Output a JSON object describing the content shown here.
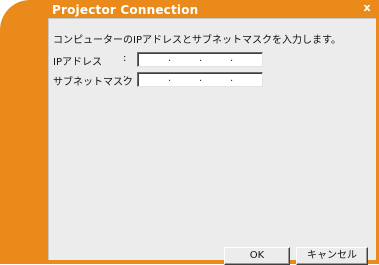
{
  "window": {
    "title": "Projector Connection",
    "close_label": "x",
    "accent_color": "#e98a1a"
  },
  "main": {
    "instruction": "コンピューターのIPアドレスとサブネットマスクを入力します。",
    "fields": {
      "ip": {
        "label": "IPアドレス",
        "colon": ":",
        "dot1": ".",
        "dot2": ".",
        "dot3": "."
      },
      "subnet": {
        "label": "サブネットマスク",
        "colon": ":",
        "dot1": ".",
        "dot2": ".",
        "dot3": "."
      }
    }
  },
  "buttons": {
    "ok_label": "OK",
    "cancel_label": "キャンセル"
  }
}
